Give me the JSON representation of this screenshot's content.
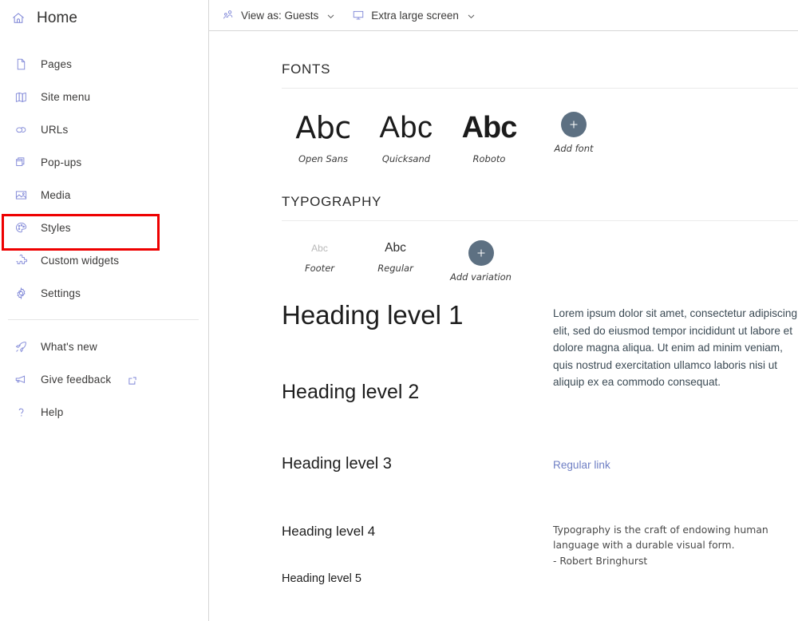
{
  "sidebar": {
    "home": {
      "label": "Home",
      "icon": "home-icon"
    },
    "items": [
      {
        "label": "Pages",
        "icon": "page-icon"
      },
      {
        "label": "Site menu",
        "icon": "book-icon"
      },
      {
        "label": "URLs",
        "icon": "link-icon"
      },
      {
        "label": "Pop-ups",
        "icon": "popup-icon"
      },
      {
        "label": "Media",
        "icon": "image-icon"
      },
      {
        "label": "Styles",
        "icon": "palette-icon"
      },
      {
        "label": "Custom widgets",
        "icon": "puzzle-icon"
      },
      {
        "label": "Settings",
        "icon": "gear-icon"
      }
    ],
    "lower_items": [
      {
        "label": "What's new",
        "icon": "rocket-icon",
        "external": false
      },
      {
        "label": "Give feedback",
        "icon": "megaphone-icon",
        "external": true
      },
      {
        "label": "Help",
        "icon": "question-icon",
        "external": false
      }
    ],
    "selected": "Styles",
    "highlight_color": "#ee0000"
  },
  "toolbar": {
    "view_as": {
      "label": "View as: Guests",
      "icon": "people-icon",
      "chevron": "chevron-down-icon"
    },
    "screen_size": {
      "label": "Extra large screen",
      "icon": "monitor-icon",
      "chevron": "chevron-down-icon"
    }
  },
  "fonts_section": {
    "title": "FONTS",
    "fonts": [
      {
        "sample": "Abc",
        "name": "Open Sans"
      },
      {
        "sample": "Abc",
        "name": "Quicksand"
      },
      {
        "sample": "Abc",
        "name": "Roboto"
      }
    ],
    "add": {
      "label": "Add font",
      "icon": "plus-icon"
    }
  },
  "typography_section": {
    "title": "TYPOGRAPHY",
    "variations": [
      {
        "sample": "Abc",
        "name": "Footer"
      },
      {
        "sample": "Abc",
        "name": "Regular"
      }
    ],
    "add": {
      "label": "Add variation",
      "icon": "plus-icon"
    },
    "headings": [
      "Heading level 1",
      "Heading level 2",
      "Heading level 3",
      "Heading level 4",
      "Heading level 5"
    ],
    "paragraph": "Lorem ipsum dolor sit amet, consectetur adipiscing elit, sed do eiusmod tempor incididunt ut labore et dolore magna aliqua. Ut enim ad minim veniam, quis nostrud exercitation ullamco laboris nisi ut aliquip ex ea commodo consequat.",
    "link_text": "Regular link",
    "quote": {
      "text": "Typography is the craft of endowing human language with a durable visual form.",
      "author": "- Robert Bringhurst"
    }
  },
  "colors": {
    "icon_accent": "#7b83d6",
    "add_circle": "#5d7082",
    "link": "#6f7fc4",
    "highlight": "#ee0000"
  }
}
